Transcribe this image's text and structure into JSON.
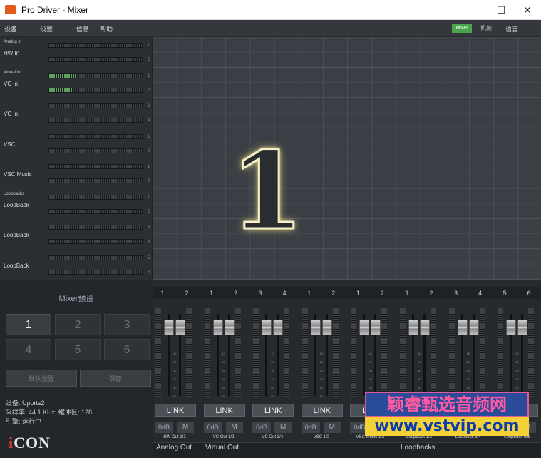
{
  "window": {
    "title": "Pro Driver - Mixer",
    "min": "—",
    "max": "☐",
    "close": "✕"
  },
  "menu": {
    "device": "设备",
    "settings": "设置",
    "info": "信息",
    "help": "帮助",
    "mode_mixer": "Mixer",
    "mode_machine": "机架",
    "language": "语言"
  },
  "inputs": [
    {
      "group": "Analog In",
      "label": "HW In",
      "levels": [
        0,
        0
      ]
    },
    {
      "group": "Virtual In",
      "label": "VC In",
      "levels": [
        0.3,
        0.25
      ]
    },
    {
      "group": "",
      "label": "VC In",
      "levels": [
        0,
        0
      ]
    },
    {
      "group": "",
      "label": "VSC",
      "levels": [
        0,
        0
      ]
    },
    {
      "group": "",
      "label": "VSC Music",
      "levels": [
        0,
        0
      ]
    },
    {
      "group": "Loopbacks",
      "label": "LoopBack",
      "levels": [
        0,
        0
      ]
    },
    {
      "group": "",
      "label": "LoopBack",
      "levels": [
        0,
        0
      ]
    },
    {
      "group": "",
      "label": "LoopBack",
      "levels": [
        0,
        0
      ]
    }
  ],
  "rownums": [
    "1",
    "2",
    "1",
    "2",
    "3",
    "4",
    "1",
    "2",
    "1",
    "2",
    "1",
    "2",
    "3",
    "4",
    "5",
    "6"
  ],
  "preset": {
    "big_number": "1",
    "title": "Mixer预设",
    "buttons": [
      "1",
      "2",
      "3",
      "4",
      "5",
      "6"
    ],
    "selected": "1",
    "reset": "默认设置",
    "save": "保存"
  },
  "status": {
    "device": "设备: Uports2",
    "sample": "采样率: 44.1 KHz; 缓冲区: 128",
    "engine": "引擎: 运行中"
  },
  "logo": {
    "i": "i",
    "rest": "CON"
  },
  "channel_numbers": [
    "1",
    "2",
    "1",
    "2",
    "3",
    "4",
    "1",
    "2",
    "1",
    "2",
    "1",
    "2",
    "3",
    "4",
    "5",
    "6"
  ],
  "outputs": [
    {
      "link": "LINK",
      "db": "0dB",
      "mute": "M",
      "label": "HW Out 1/2"
    },
    {
      "link": "LINK",
      "db": "0dB",
      "mute": "M",
      "label": "VC Out 1/2"
    },
    {
      "link": "LINK",
      "db": "0dB",
      "mute": "M",
      "label": "VC Out 3/4"
    },
    {
      "link": "LINK",
      "db": "0dB",
      "mute": "M",
      "label": "VSC 1/2"
    },
    {
      "link": "LINK",
      "db": "0dB",
      "mute": "M",
      "label": "VSC Music 1/2"
    },
    {
      "link": "LINK",
      "db": "0dB",
      "mute": "M",
      "label": "Loopback 1/2"
    },
    {
      "link": "LINK",
      "db": "0dB",
      "mute": "M",
      "label": "Loopback 3/4"
    },
    {
      "link": "LINK",
      "db": "0dB",
      "mute": "M",
      "label": "Loopback 5/6"
    }
  ],
  "fader_ticks": [
    "10",
    "20",
    "30",
    "40",
    "50",
    "60"
  ],
  "sections": {
    "analog": "Analog Out",
    "virtual": "Virtual Out",
    "loopbacks": "Loopbacks"
  },
  "watermark": {
    "line1": "颖睿甄选音频网",
    "line2": "www.vstvip.com"
  },
  "colors": {
    "active_mode": "#4ca34c",
    "glow": "#f2e8a8",
    "meter_green": "#5ea05e",
    "logo_red": "#d23a2a"
  }
}
